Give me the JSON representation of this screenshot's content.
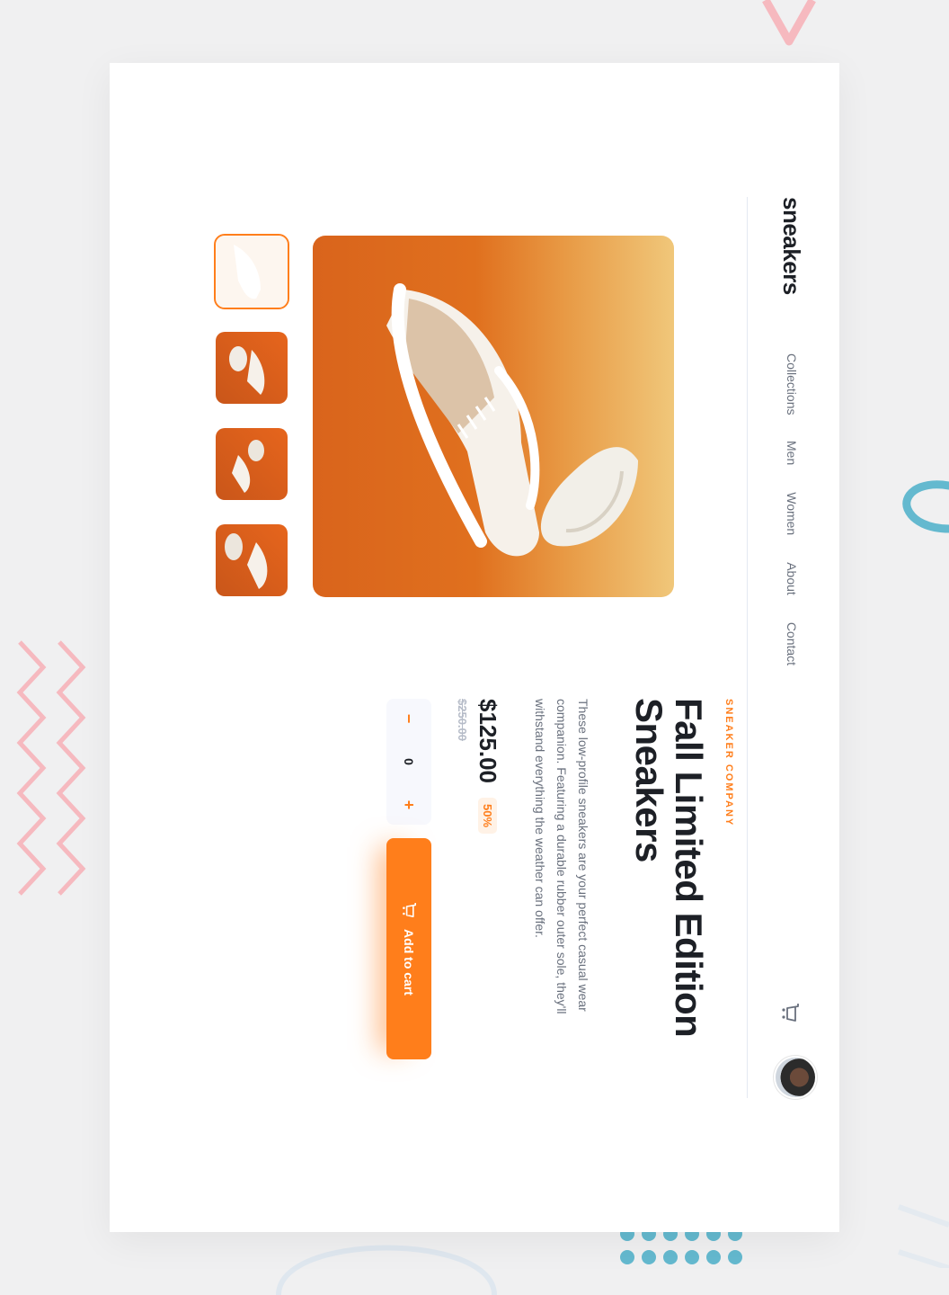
{
  "brand": {
    "logo": "sneakers"
  },
  "nav": {
    "items": [
      {
        "label": "Collections"
      },
      {
        "label": "Men"
      },
      {
        "label": "Women"
      },
      {
        "label": "About"
      },
      {
        "label": "Contact"
      }
    ]
  },
  "header": {
    "cart_icon": "cart-icon",
    "avatar_icon": "avatar"
  },
  "gallery": {
    "main_image": "white and beige sneaker on orange background",
    "thumbnails": [
      "thumbnail-1",
      "thumbnail-2",
      "thumbnail-3",
      "thumbnail-4"
    ],
    "active_thumbnail": 1
  },
  "product": {
    "company": "SNEAKER COMPANY",
    "title": "Fall Limited Edition Sneakers",
    "description": "These low-profile sneakers are your perfect casual wear companion. Featuring a durable rubber outer sole, they'll withstand everything the weather can offer.",
    "price": "$125.00",
    "discount": "50%",
    "original_price": "$250.00"
  },
  "cart_controls": {
    "minus_label": "−",
    "quantity": "0",
    "plus_label": "+",
    "add_label": "Add to cart"
  },
  "colors": {
    "accent": "#ff7e1b",
    "dark": "#1d2026",
    "muted": "#69707d",
    "decor_pink": "#f6b9bf",
    "decor_blue": "#64b9cf"
  }
}
